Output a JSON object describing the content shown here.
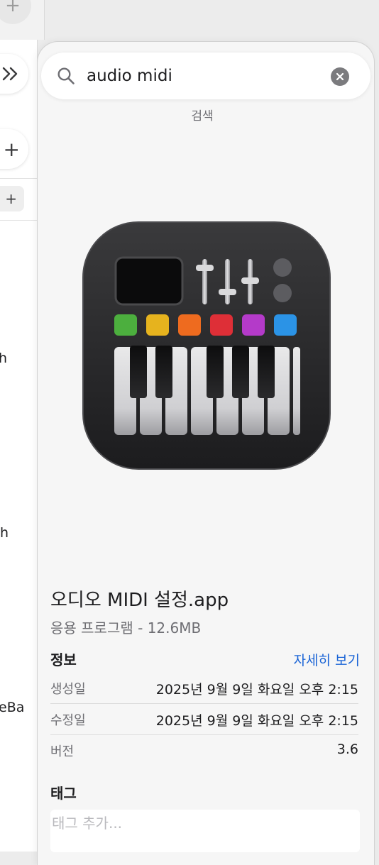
{
  "background_window": {
    "top_plus": "+",
    "strip_plus": "+",
    "tag_plus": "+",
    "partial_texts": [
      "h",
      ".h",
      "eBa"
    ]
  },
  "search": {
    "query": "audio midi",
    "caption": "검색"
  },
  "file": {
    "name": "오디오 MIDI 설정.app",
    "kind_size": "응용 프로그램 - 12.6MB",
    "icon": "audio-midi-setup-app-icon"
  },
  "info": {
    "heading": "정보",
    "more_link": "자세히 보기",
    "rows": [
      {
        "label": "생성일",
        "value": "2025년 9월 9일 화요일 오후 2:15"
      },
      {
        "label": "수정일",
        "value": "2025년 9월 9일 화요일 오후 2:15"
      },
      {
        "label": "버전",
        "value": "3.6"
      }
    ]
  },
  "tags": {
    "heading": "태그",
    "placeholder": "태그 추가..."
  },
  "colors": {
    "link": "#1a64d6",
    "pad_colors": [
      "#4caf3e",
      "#e6b31e",
      "#ee6b1f",
      "#de2f37",
      "#b43ac9",
      "#2b93e6"
    ]
  }
}
